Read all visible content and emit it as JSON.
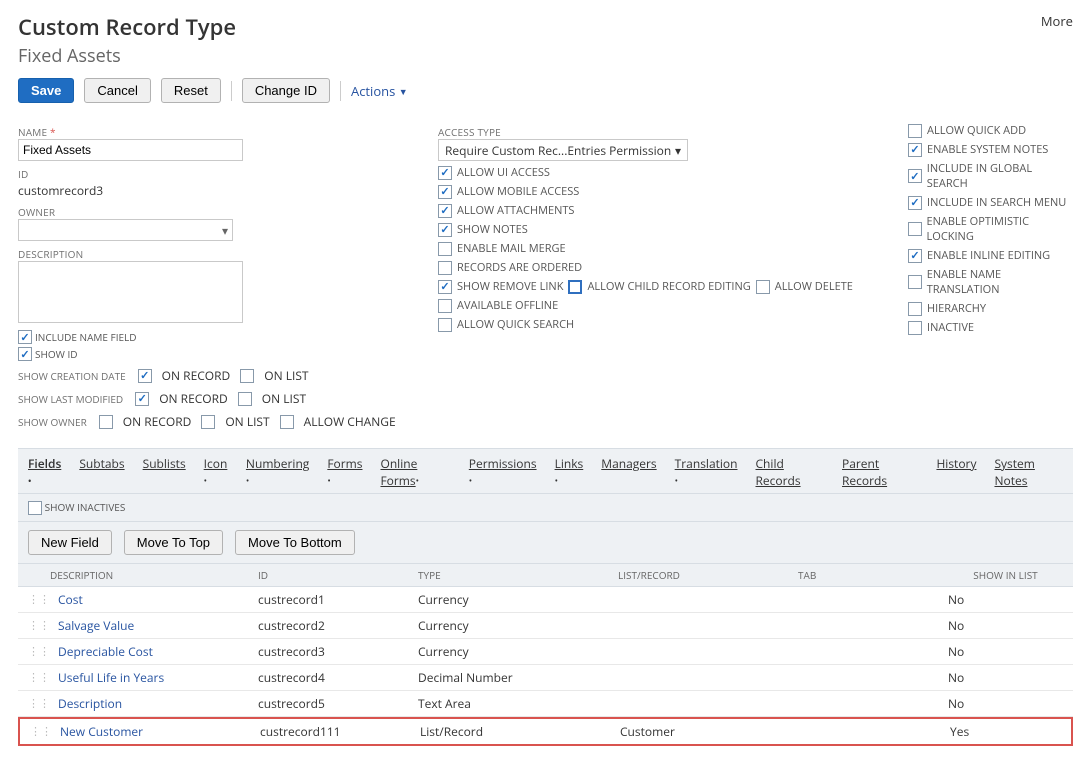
{
  "header": {
    "title": "Custom Record Type",
    "subtitle": "Fixed Assets",
    "more": "More"
  },
  "buttons": {
    "save": "Save",
    "cancel": "Cancel",
    "reset": "Reset",
    "change_id": "Change ID",
    "actions": "Actions"
  },
  "left": {
    "name_lbl": "NAME",
    "name_val": "Fixed Assets",
    "id_lbl": "ID",
    "id_val": "customrecord3",
    "owner_lbl": "OWNER",
    "desc_lbl": "DESCRIPTION",
    "include_name": "INCLUDE NAME FIELD",
    "show_id": "SHOW ID",
    "scd_lbl": "SHOW CREATION DATE",
    "slm_lbl": "SHOW LAST MODIFIED",
    "so_lbl": "SHOW OWNER",
    "on_record": "ON RECORD",
    "on_list": "ON LIST",
    "allow_change": "ALLOW CHANGE"
  },
  "mid": {
    "access_lbl": "ACCESS TYPE",
    "access_val": "Require Custom Rec...Entries Permission",
    "items": [
      {
        "label": "ALLOW UI ACCESS",
        "on": true
      },
      {
        "label": "ALLOW MOBILE ACCESS",
        "on": true
      },
      {
        "label": "ALLOW ATTACHMENTS",
        "on": true
      },
      {
        "label": "SHOW NOTES",
        "on": true
      },
      {
        "label": "ENABLE MAIL MERGE",
        "on": false
      },
      {
        "label": "RECORDS ARE ORDERED",
        "on": false
      }
    ],
    "srl": "SHOW REMOVE LINK",
    "acre": "ALLOW CHILD RECORD EDITING",
    "allow_delete": "ALLOW DELETE",
    "avail_offline": "AVAILABLE OFFLINE",
    "quick_search": "ALLOW QUICK SEARCH"
  },
  "right": {
    "items": [
      {
        "label": "ALLOW QUICK ADD",
        "on": false
      },
      {
        "label": "ENABLE SYSTEM NOTES",
        "on": true
      },
      {
        "label": "INCLUDE IN GLOBAL SEARCH",
        "on": true
      },
      {
        "label": "INCLUDE IN SEARCH MENU",
        "on": true
      },
      {
        "label": "ENABLE OPTIMISTIC LOCKING",
        "on": false
      },
      {
        "label": "ENABLE INLINE EDITING",
        "on": true
      },
      {
        "label": "ENABLE NAME TRANSLATION",
        "on": false
      },
      {
        "label": "HIERARCHY",
        "on": false
      },
      {
        "label": "INACTIVE",
        "on": false
      }
    ]
  },
  "subtabs": [
    "Fields",
    "Subtabs",
    "Sublists",
    "Icon",
    "Numbering",
    "Forms",
    "Online Forms",
    "Permissions",
    "Links",
    "Managers",
    "Translation",
    "Child Records",
    "Parent Records",
    "History",
    "System Notes"
  ],
  "subtab_dots": {
    "Fields": true,
    "Icon": true,
    "Numbering": true,
    "Forms": true,
    "Online Forms": true,
    "Permissions": true,
    "Links": true,
    "Translation": true
  },
  "show_inactives": "SHOW INACTIVES",
  "grid_buttons": {
    "new": "New Field",
    "top": "Move To Top",
    "bottom": "Move To Bottom"
  },
  "columns": {
    "desc": "DESCRIPTION",
    "id": "ID",
    "type": "TYPE",
    "lr": "LIST/RECORD",
    "tab": "TAB",
    "sil": "SHOW IN LIST"
  },
  "rows": [
    {
      "desc": "Cost",
      "id": "custrecord1",
      "type": "Currency",
      "lr": "",
      "tab": "",
      "sil": "No",
      "hl": false
    },
    {
      "desc": "Salvage Value",
      "id": "custrecord2",
      "type": "Currency",
      "lr": "",
      "tab": "",
      "sil": "No",
      "hl": false
    },
    {
      "desc": "Depreciable Cost",
      "id": "custrecord3",
      "type": "Currency",
      "lr": "",
      "tab": "",
      "sil": "No",
      "hl": false
    },
    {
      "desc": "Useful Life in Years",
      "id": "custrecord4",
      "type": "Decimal Number",
      "lr": "",
      "tab": "",
      "sil": "No",
      "hl": false
    },
    {
      "desc": "Description",
      "id": "custrecord5",
      "type": "Text Area",
      "lr": "",
      "tab": "",
      "sil": "No",
      "hl": false
    },
    {
      "desc": "New Customer",
      "id": "custrecord111",
      "type": "List/Record",
      "lr": "Customer",
      "tab": "",
      "sil": "Yes",
      "hl": true
    }
  ]
}
